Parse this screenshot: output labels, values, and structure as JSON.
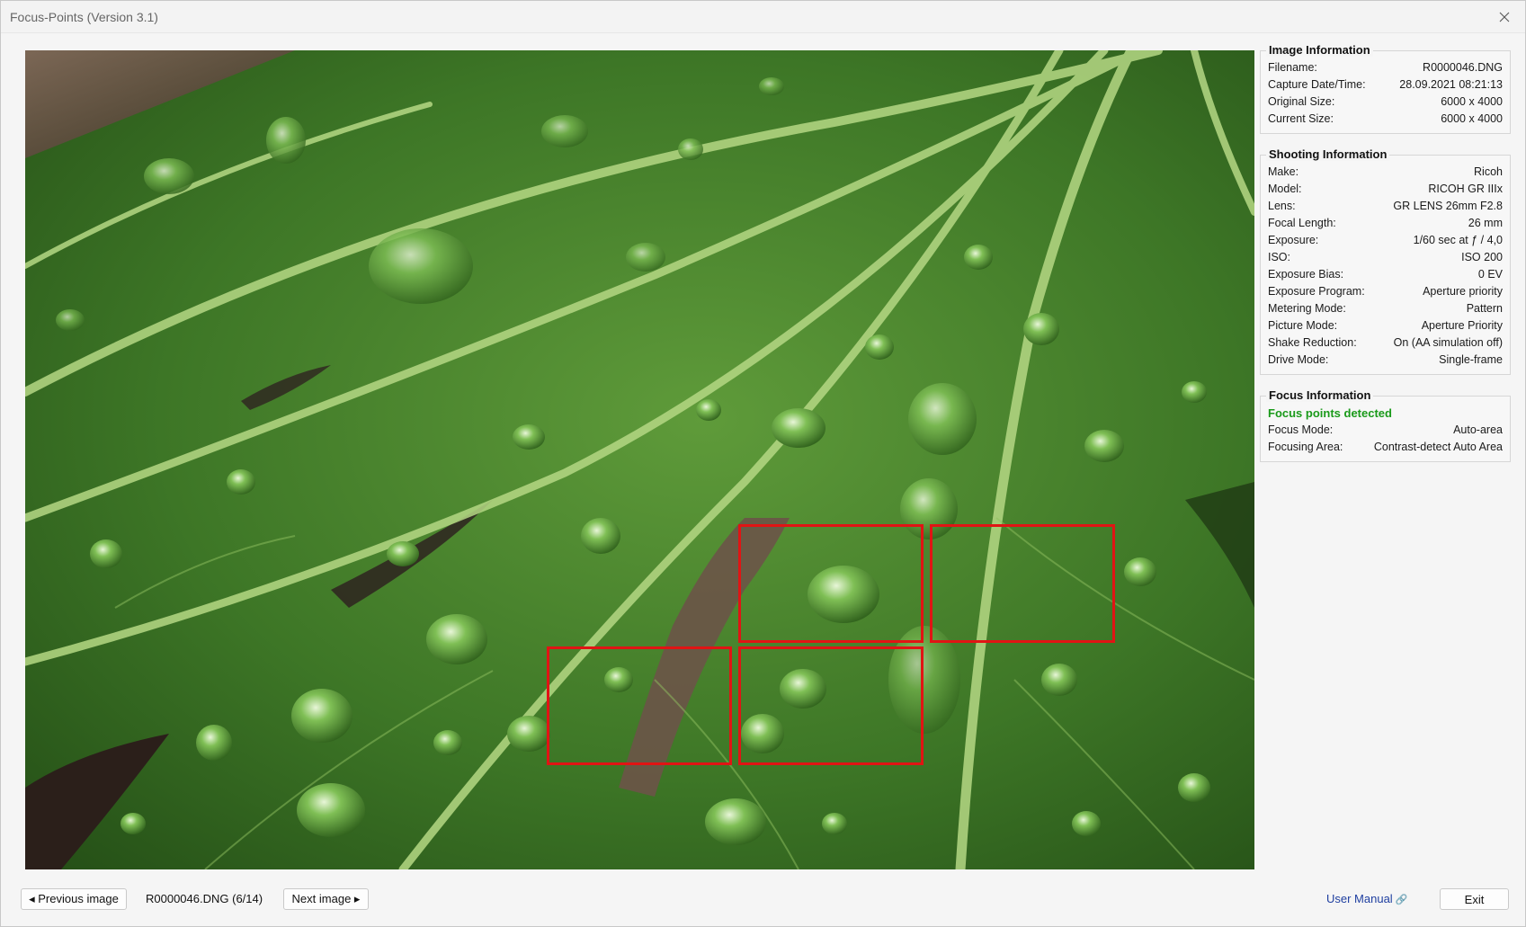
{
  "window": {
    "title": "Focus-Points (Version 3.1)",
    "close_icon": "close-icon"
  },
  "image_information": {
    "heading": "Image Information",
    "rows": [
      {
        "label": "Filename:",
        "value": "R0000046.DNG"
      },
      {
        "label": "Capture Date/Time:",
        "value": "28.09.2021 08:21:13"
      },
      {
        "label": "Original Size:",
        "value": "6000 x 4000"
      },
      {
        "label": "Current Size:",
        "value": "6000 x 4000"
      }
    ]
  },
  "shooting_information": {
    "heading": "Shooting Information",
    "rows": [
      {
        "label": "Make:",
        "value": "Ricoh"
      },
      {
        "label": "Model:",
        "value": "RICOH GR IIIx"
      },
      {
        "label": "Lens:",
        "value": "GR LENS 26mm F2.8"
      },
      {
        "label": "Focal Length:",
        "value": "26 mm"
      },
      {
        "label": "Exposure:",
        "value": "1/60 sec at ƒ / 4,0"
      },
      {
        "label": "ISO:",
        "value": "ISO 200"
      },
      {
        "label": "Exposure Bias:",
        "value": "0 EV"
      },
      {
        "label": "Exposure Program:",
        "value": "Aperture priority"
      },
      {
        "label": "Metering Mode:",
        "value": "Pattern"
      },
      {
        "label": "Picture Mode:",
        "value": "Aperture Priority"
      },
      {
        "label": "Shake Reduction:",
        "value": "On (AA simulation off)"
      },
      {
        "label": "Drive Mode:",
        "value": "Single-frame"
      }
    ]
  },
  "focus_information": {
    "heading": "Focus Information",
    "status": "Focus points detected",
    "status_color": "#1a9a1a",
    "rows": [
      {
        "label": "Focus Mode:",
        "value": "Auto-area"
      },
      {
        "label": "Focusing Area:",
        "value": "Contrast-detect Auto Area"
      }
    ]
  },
  "focus_points": {
    "count": 4,
    "color": "#e11414"
  },
  "bottom": {
    "previous_label": "◂ Previous image",
    "counter": "R0000046.DNG (6/14)",
    "next_label": "Next image ▸",
    "manual_label": "User Manual",
    "manual_icon": "external-link-icon",
    "exit_label": "Exit"
  }
}
